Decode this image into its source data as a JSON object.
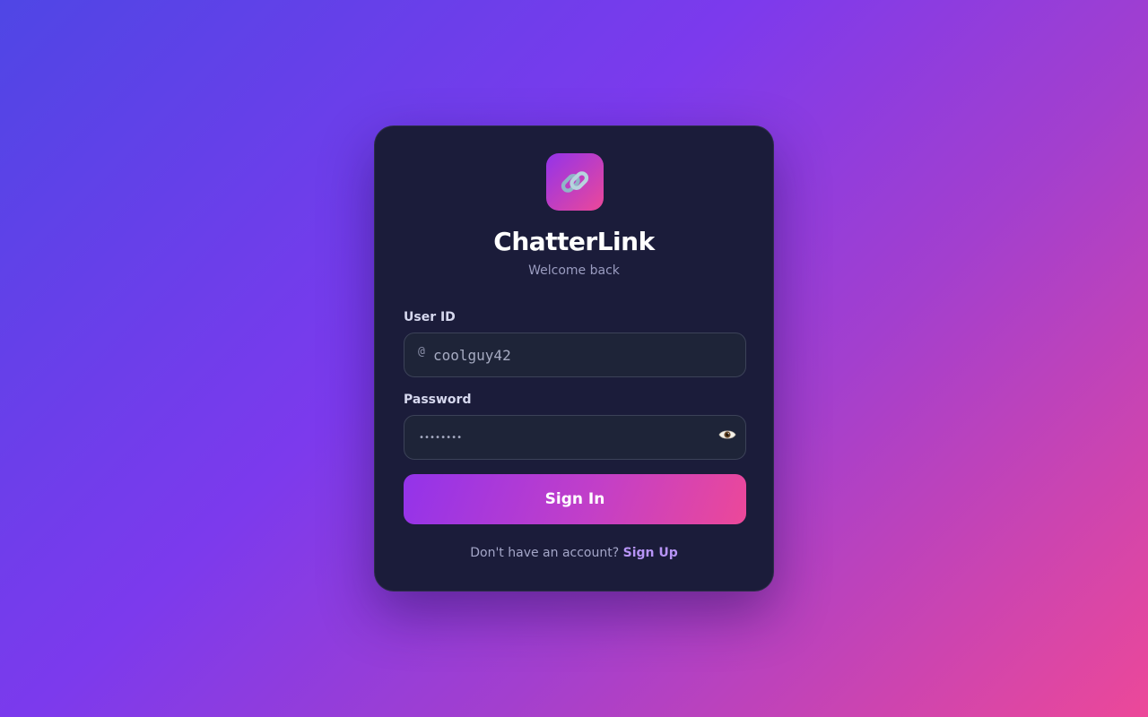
{
  "app": {
    "name": "ChatterLink",
    "subtitle": "Welcome back",
    "logo_icon": "link-icon"
  },
  "form": {
    "user_id": {
      "label": "User ID",
      "prefix": "@",
      "value": "coolguy42"
    },
    "password": {
      "label": "Password",
      "value": "••••••••",
      "toggle_icon": "eye-icon"
    },
    "submit_label": "Sign In"
  },
  "footer": {
    "prompt": "Don't have an account?",
    "link_label": "Sign Up"
  },
  "colors": {
    "card_bg": "#1b1c3a",
    "field_bg": "#1e2438",
    "accent_start": "#9333ea",
    "accent_end": "#ec4899",
    "link": "#b794f6"
  }
}
